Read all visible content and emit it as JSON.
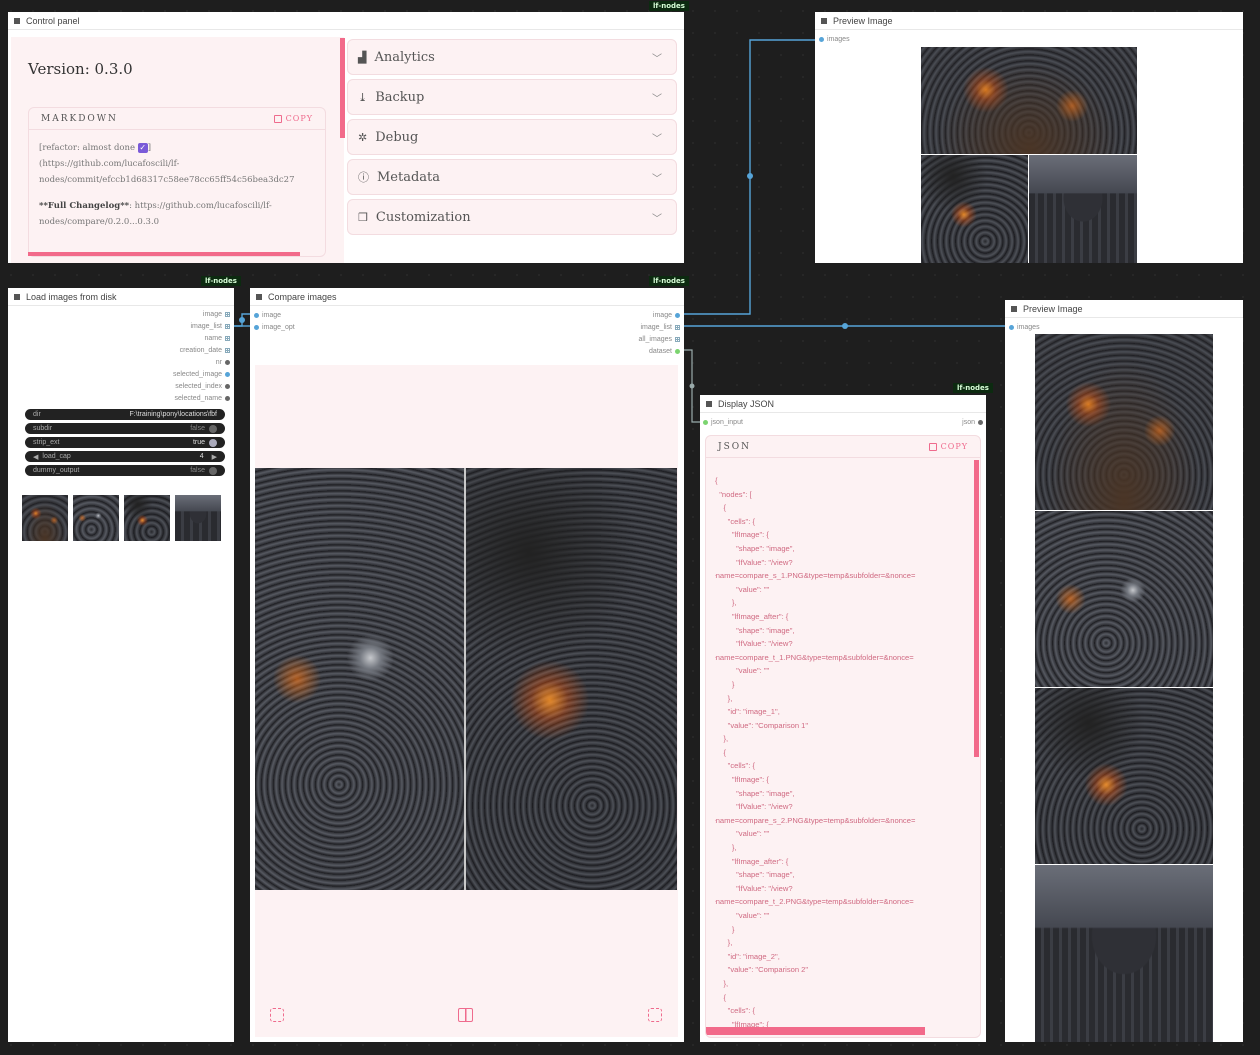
{
  "badges": {
    "lf_nodes": "lf-nodes"
  },
  "control_panel": {
    "title": "Control panel",
    "version": "Version: 0.3.0",
    "markdown_label": "MARKDOWN",
    "copy_label": "COPY",
    "md_line1_a": "[refactor: almost done ",
    "md_line1_b": "]",
    "md_line2": "(https://github.com/lucafoscili/lf-",
    "md_line3": "nodes/commit/efccb1d68317c58ee78cc65ff54c56bea3dc27",
    "md_line4_bold": "**Full Changelog**",
    "md_line4_rest": ": https://github.com/lucafoscili/lf-",
    "md_line5": "nodes/compare/0.2.0...0.3.0",
    "sections": [
      {
        "label": "Analytics",
        "icon": "chart-icon"
      },
      {
        "label": "Backup",
        "icon": "download-icon"
      },
      {
        "label": "Debug",
        "icon": "bug-icon"
      },
      {
        "label": "Metadata",
        "icon": "info-icon"
      },
      {
        "label": "Customization",
        "icon": "palette-icon"
      }
    ]
  },
  "preview_top": {
    "title": "Preview Image",
    "slot": "images"
  },
  "preview_right": {
    "title": "Preview Image",
    "slot": "images"
  },
  "load_images": {
    "title": "Load images from disk",
    "outputs": [
      "image",
      "image_list",
      "name",
      "creation_date",
      "nr",
      "selected_image",
      "selected_index",
      "selected_name"
    ],
    "widgets": {
      "dir_label": "dir",
      "dir_value": "F:\\training\\pony\\locations\\fbf",
      "subdir_label": "subdir",
      "subdir_value": "false",
      "strip_ext_label": "strip_ext",
      "strip_ext_value": "true",
      "load_cap_label": "load_cap",
      "load_cap_value": "4",
      "dummy_label": "dummy_output",
      "dummy_value": "false"
    }
  },
  "compare": {
    "title": "Compare images",
    "inputs": [
      "image",
      "image_opt"
    ],
    "outputs": [
      "image",
      "image_list",
      "all_images",
      "dataset"
    ]
  },
  "display_json": {
    "title": "Display JSON",
    "input": "json_input",
    "output": "json",
    "label": "JSON",
    "copy_label": "COPY",
    "lines": [
      "{",
      "  \"nodes\": [",
      "    {",
      "      \"cells\": {",
      "        \"lfImage\": {",
      "          \"shape\": \"image\",",
      "          \"lfValue\": \"/view?",
      "filename=compare_s_1.PNG&type=temp&subfolder=&nonce=",
      "          \"value\": \"\"",
      "        },",
      "        \"lfImage_after\": {",
      "          \"shape\": \"image\",",
      "          \"lfValue\": \"/view?",
      "filename=compare_t_1.PNG&type=temp&subfolder=&nonce=",
      "          \"value\": \"\"",
      "        }",
      "      },",
      "      \"id\": \"image_1\",",
      "      \"value\": \"Comparison 1\"",
      "    },",
      "    {",
      "      \"cells\": {",
      "        \"lfImage\": {",
      "          \"shape\": \"image\",",
      "          \"lfValue\": \"/view?",
      "filename=compare_s_2.PNG&type=temp&subfolder=&nonce=",
      "          \"value\": \"\"",
      "        },",
      "        \"lfImage_after\": {",
      "          \"shape\": \"image\",",
      "          \"lfValue\": \"/view?",
      "filename=compare_t_2.PNG&type=temp&subfolder=&nonce=",
      "          \"value\": \"\"",
      "        }",
      "      },",
      "      \"id\": \"image_2\",",
      "      \"value\": \"Comparison 2\"",
      "    },",
      "    {",
      "      \"cells\": {",
      "        \"lfImage\": {"
    ]
  },
  "colors": {
    "accent": "#f26a8a",
    "link": "#56a4d8",
    "panel": "#fdf2f3"
  }
}
